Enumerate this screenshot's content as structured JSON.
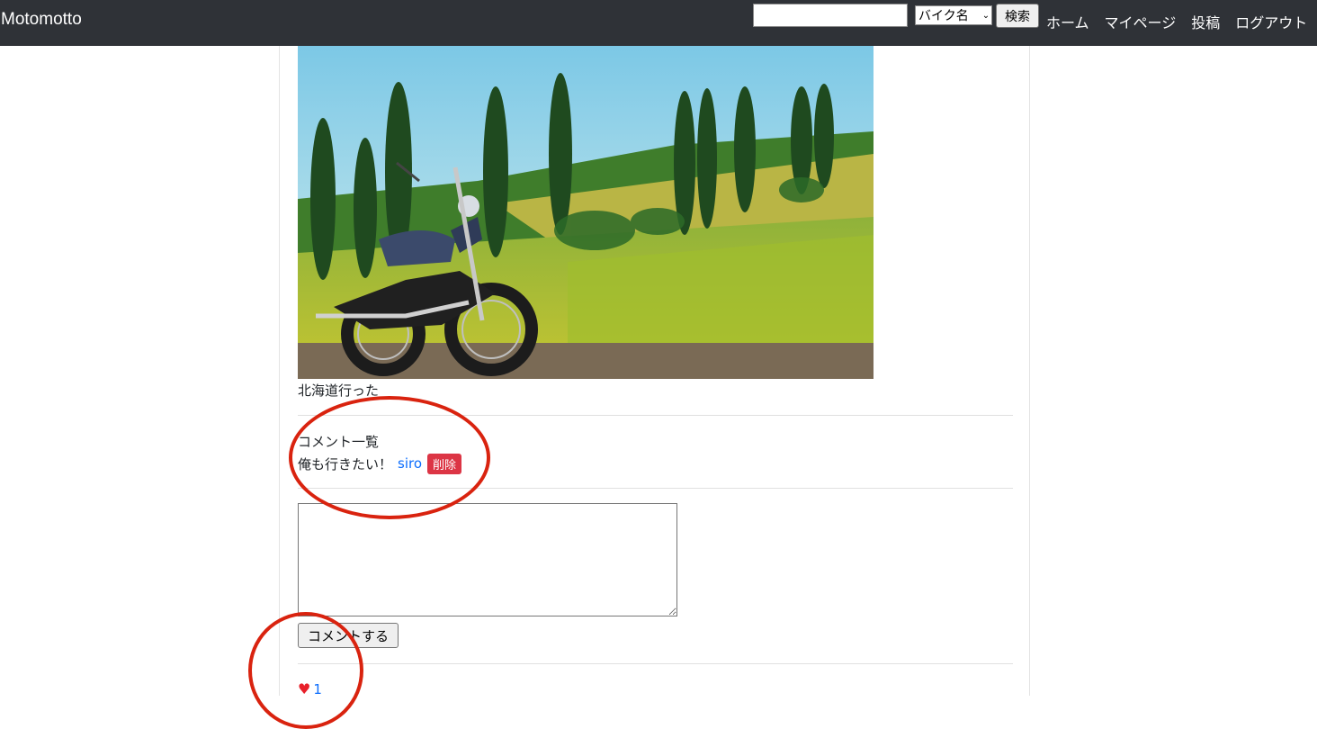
{
  "navbar": {
    "brand": "Motomotto",
    "search": {
      "value": "",
      "placeholder": "",
      "select_value": "バイク名",
      "button_label": "検索"
    },
    "links": [
      "ホーム",
      "マイページ",
      "投稿",
      "ログアウト"
    ]
  },
  "post": {
    "photo_subject": "motorcycle parked by a grassy field with tall poplar trees under a blue sky",
    "caption": "北海道行った"
  },
  "comments": {
    "heading": "コメント一覧",
    "items": [
      {
        "text": "俺も行きたい！",
        "user": "siro",
        "delete_label": "削除"
      }
    ]
  },
  "comment_form": {
    "value": "",
    "submit_label": "コメントする"
  },
  "likes": {
    "icon": "heart-icon",
    "count": "1"
  },
  "colors": {
    "navbar_bg": "#2f3237",
    "link": "#0d6efd",
    "danger": "#dc3545",
    "annotation": "#d9230f",
    "heart": "#e8202a"
  }
}
